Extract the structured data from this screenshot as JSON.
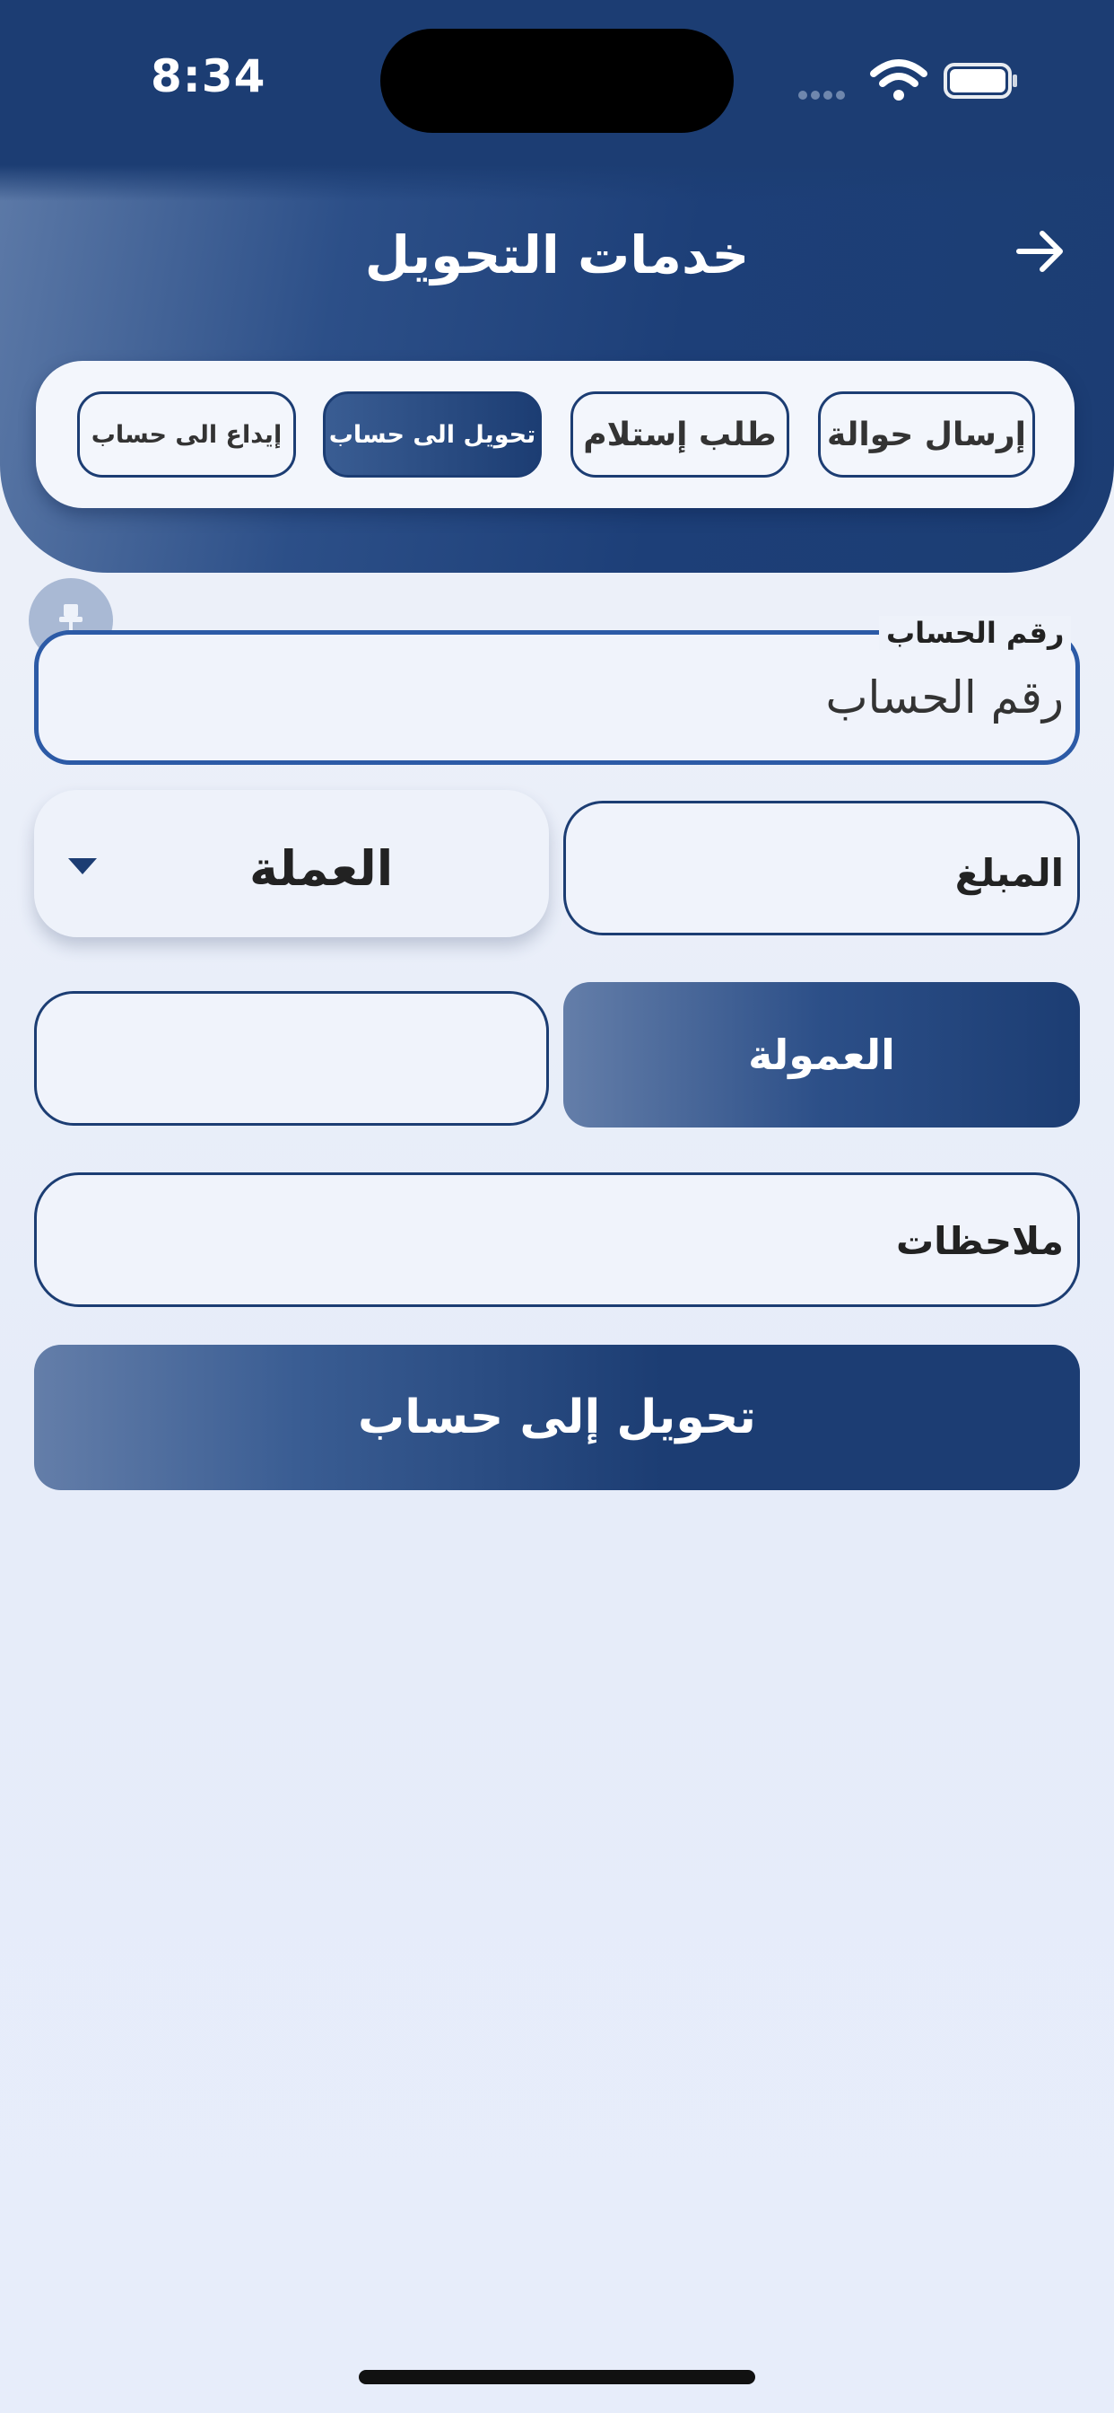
{
  "status_bar": {
    "time": "8:34"
  },
  "header": {
    "title": "خدمات التحويل"
  },
  "tabs": [
    {
      "label": "إرسال حوالة",
      "active": false
    },
    {
      "label": "طلب إستلام",
      "active": false
    },
    {
      "label": "تحويل الى حساب",
      "active": true
    },
    {
      "label": "إيداع الى حساب",
      "active": false
    }
  ],
  "form": {
    "account_label": "رقم الحساب",
    "account_placeholder": "رقم الحساب",
    "amount_label": "المبلغ",
    "currency_label": "العملة",
    "commission_label": "العمولة",
    "commission_value": "",
    "notes_label": "ملاحظات",
    "submit_label": "تحويل إلى حساب"
  },
  "colors": {
    "primary": "#1c3d73",
    "accent_border": "#2c5aa6",
    "background": "#e8eefa"
  },
  "icons": {
    "back": "arrow-right-icon",
    "pin": "pin-icon",
    "wifi": "wifi-icon",
    "battery": "battery-icon",
    "caret": "caret-down-icon"
  }
}
